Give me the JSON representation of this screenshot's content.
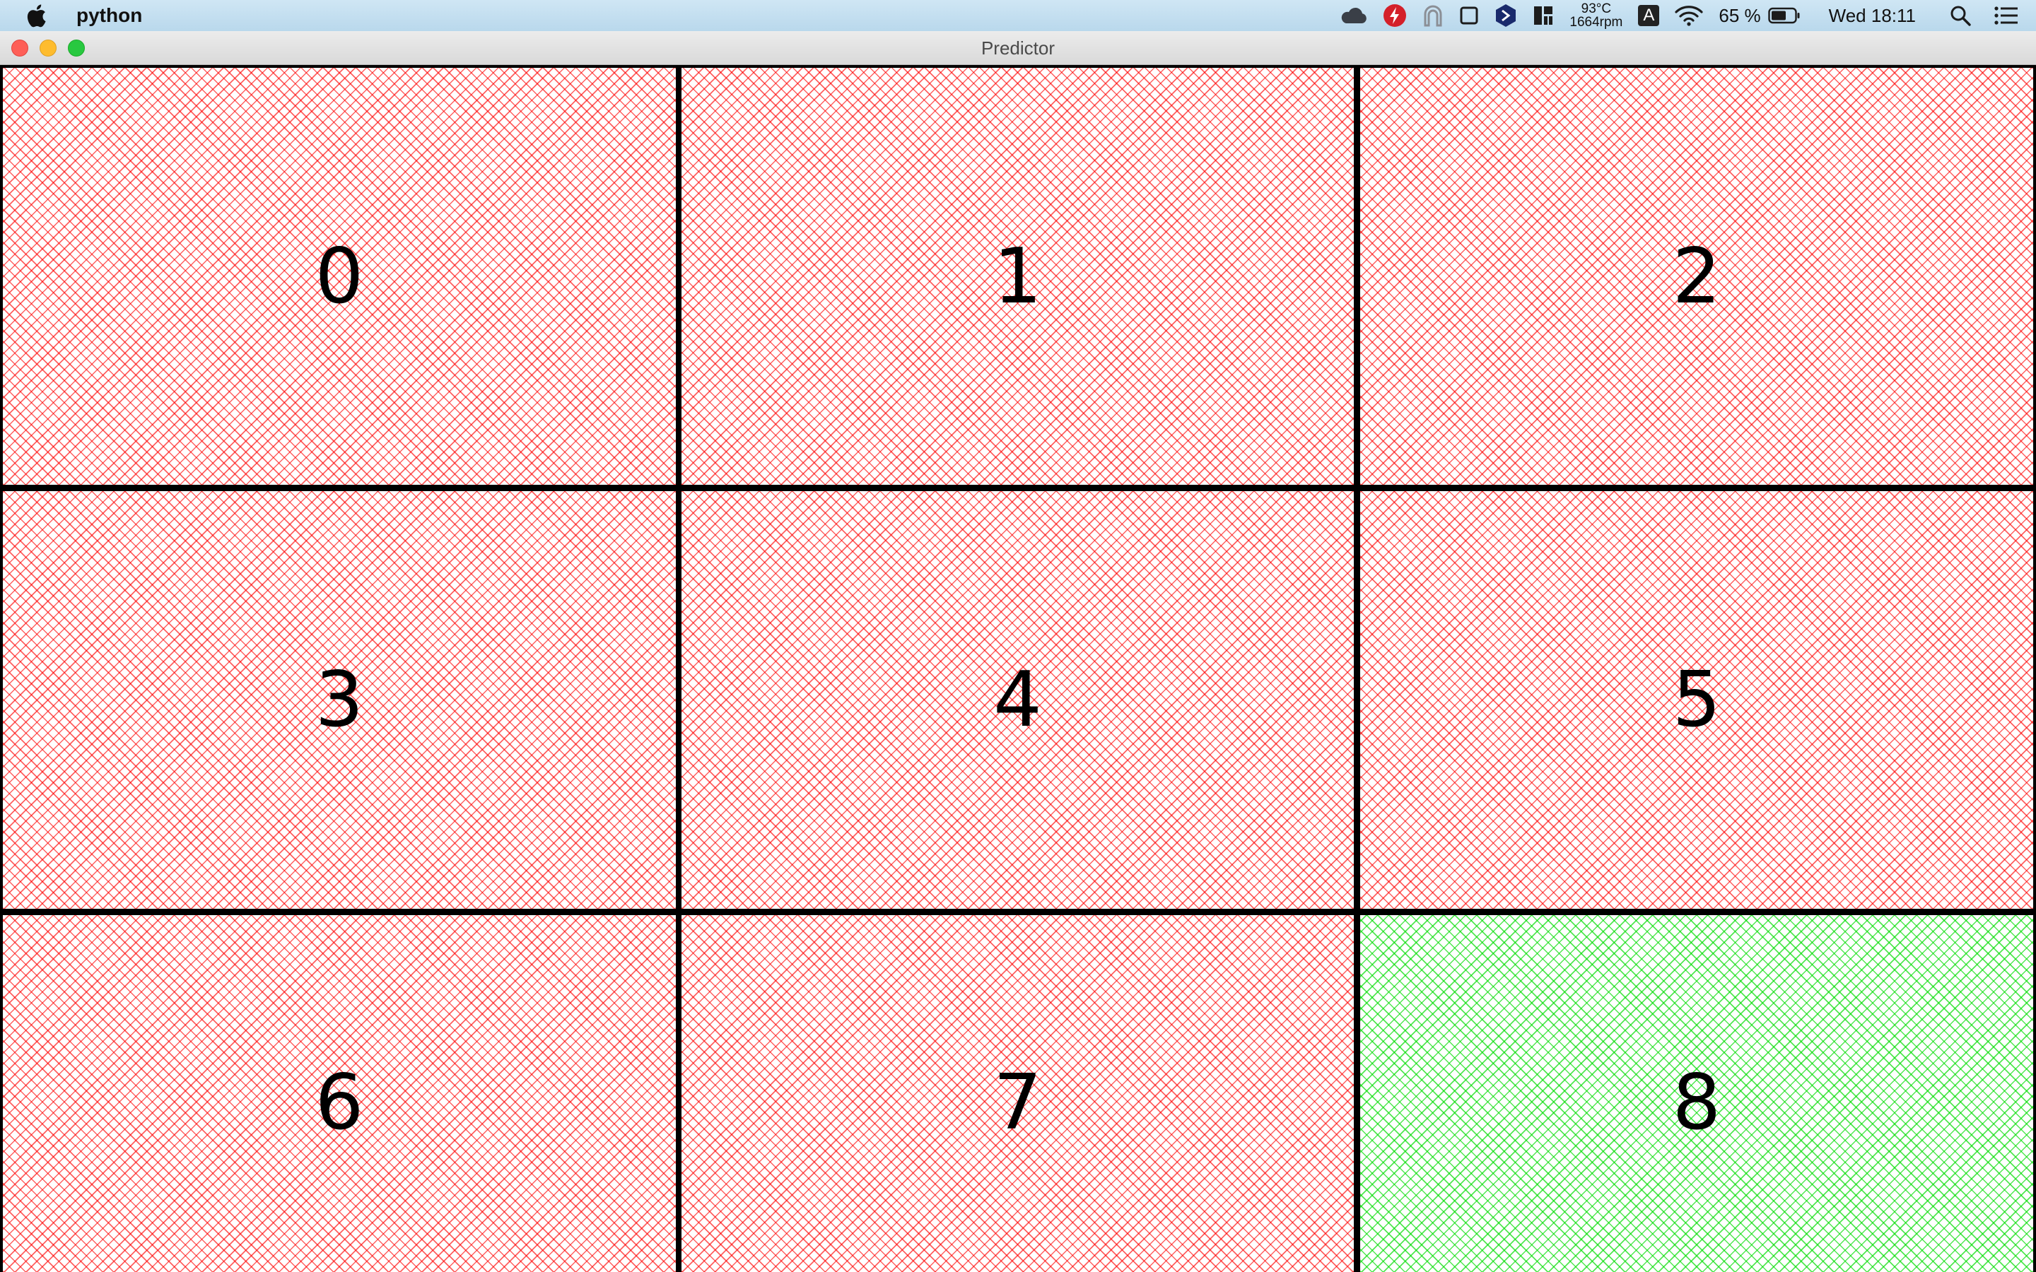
{
  "menubar": {
    "app_name": "python",
    "temperature": "93°C",
    "fan_speed": "1664rpm",
    "input_source": "A",
    "battery_percent": "65 %",
    "clock": "Wed 18:11",
    "icons": [
      "apple-icon",
      "cloud-icon",
      "flash-icon",
      "arch-icon",
      "square-icon",
      "hexagon-icon",
      "panels-icon",
      "wifi-icon",
      "battery-icon",
      "search-icon",
      "list-icon"
    ]
  },
  "window": {
    "title": "Predictor"
  },
  "grid": {
    "cells": [
      {
        "label": "0",
        "state": "red"
      },
      {
        "label": "1",
        "state": "red"
      },
      {
        "label": "2",
        "state": "red"
      },
      {
        "label": "3",
        "state": "red"
      },
      {
        "label": "4",
        "state": "red"
      },
      {
        "label": "5",
        "state": "red"
      },
      {
        "label": "6",
        "state": "red"
      },
      {
        "label": "7",
        "state": "red"
      },
      {
        "label": "8",
        "state": "green"
      }
    ],
    "colors": {
      "red": "#ff0000",
      "green": "#00dc00",
      "border": "#000000"
    }
  }
}
